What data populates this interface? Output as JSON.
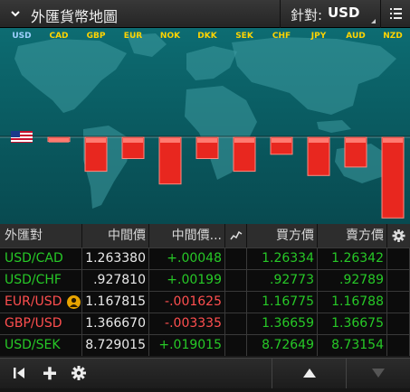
{
  "header": {
    "title": "外匯貨幣地圖",
    "vs_label": "針對:",
    "vs_currency": "USD"
  },
  "map": {
    "currencies": [
      "USD",
      "CAD",
      "GBP",
      "EUR",
      "NOK",
      "DKK",
      "SEK",
      "CHF",
      "JPY",
      "AUD",
      "NZD"
    ],
    "base_currency": "USD",
    "relative_change_pct": [
      0,
      -0.1,
      -0.8,
      -0.5,
      -1.1,
      -0.5,
      -0.8,
      -0.4,
      -0.9,
      -0.7,
      -1.9
    ],
    "label_color_base": "#9fd0ff",
    "label_color_other": "#ffd400",
    "bar_color": "#e8271f"
  },
  "table": {
    "columns": {
      "pair": "外匯對",
      "mid": "中間價",
      "change": "中間價...",
      "bid": "買方價",
      "ask": "賣方價"
    },
    "rows": [
      {
        "pair": "USD/CAD",
        "mid": "1.263380",
        "change": "+.00048",
        "bid": "1.26334",
        "ask": "1.26342",
        "color": "green"
      },
      {
        "pair": "USD/CHF",
        "mid": ".927810",
        "change": "+.00199",
        "bid": ".92773",
        "ask": ".92789",
        "color": "green"
      },
      {
        "pair": "EUR/USD",
        "mid": "1.167815",
        "change": "-.001625",
        "bid": "1.16775",
        "ask": "1.16788",
        "color": "red",
        "alert": true
      },
      {
        "pair": "GBP/USD",
        "mid": "1.366670",
        "change": "-.003335",
        "bid": "1.36659",
        "ask": "1.36675",
        "color": "red"
      },
      {
        "pair": "USD/SEK",
        "mid": "8.729015",
        "change": "+.019015",
        "bid": "8.72649",
        "ask": "8.73154",
        "color": "green"
      }
    ]
  },
  "colors": {
    "positive": "#27c927",
    "negative": "#ff4f4f",
    "alert": "#e8a400"
  }
}
